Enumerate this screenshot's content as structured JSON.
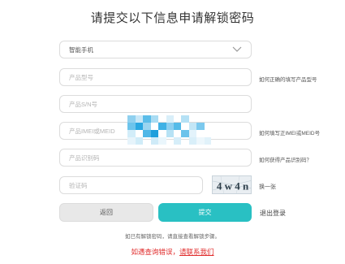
{
  "page": {
    "title": "请提交以下信息申请解锁密码"
  },
  "form": {
    "device_type": {
      "value": "智能手机",
      "icon": "chevron-down-icon"
    },
    "model": {
      "placeholder": "产品型号"
    },
    "serial": {
      "placeholder": "产品S/N号"
    },
    "imei": {
      "placeholder": "产品IMEI或MEID"
    },
    "product_id": {
      "placeholder": "产品识别码"
    },
    "captcha": {
      "placeholder": "验证码",
      "image_text": "4 w 4 n"
    }
  },
  "hints": {
    "model": "如何正确的填写产品型号",
    "imei": "如何填写正IMEI或MEID号",
    "product_id": "如何获得产品识别码？",
    "captcha": "换一张"
  },
  "buttons": {
    "back": "返回",
    "submit": "提交",
    "logout": "退出登录"
  },
  "footer": {
    "note": "如已有解锁密码，请直接查看解锁步骤。",
    "error_prefix": "如遇查询错误，",
    "contact_link": "请联系我们"
  },
  "colors": {
    "accent": "#29c0c3",
    "error": "#e02b2b"
  }
}
